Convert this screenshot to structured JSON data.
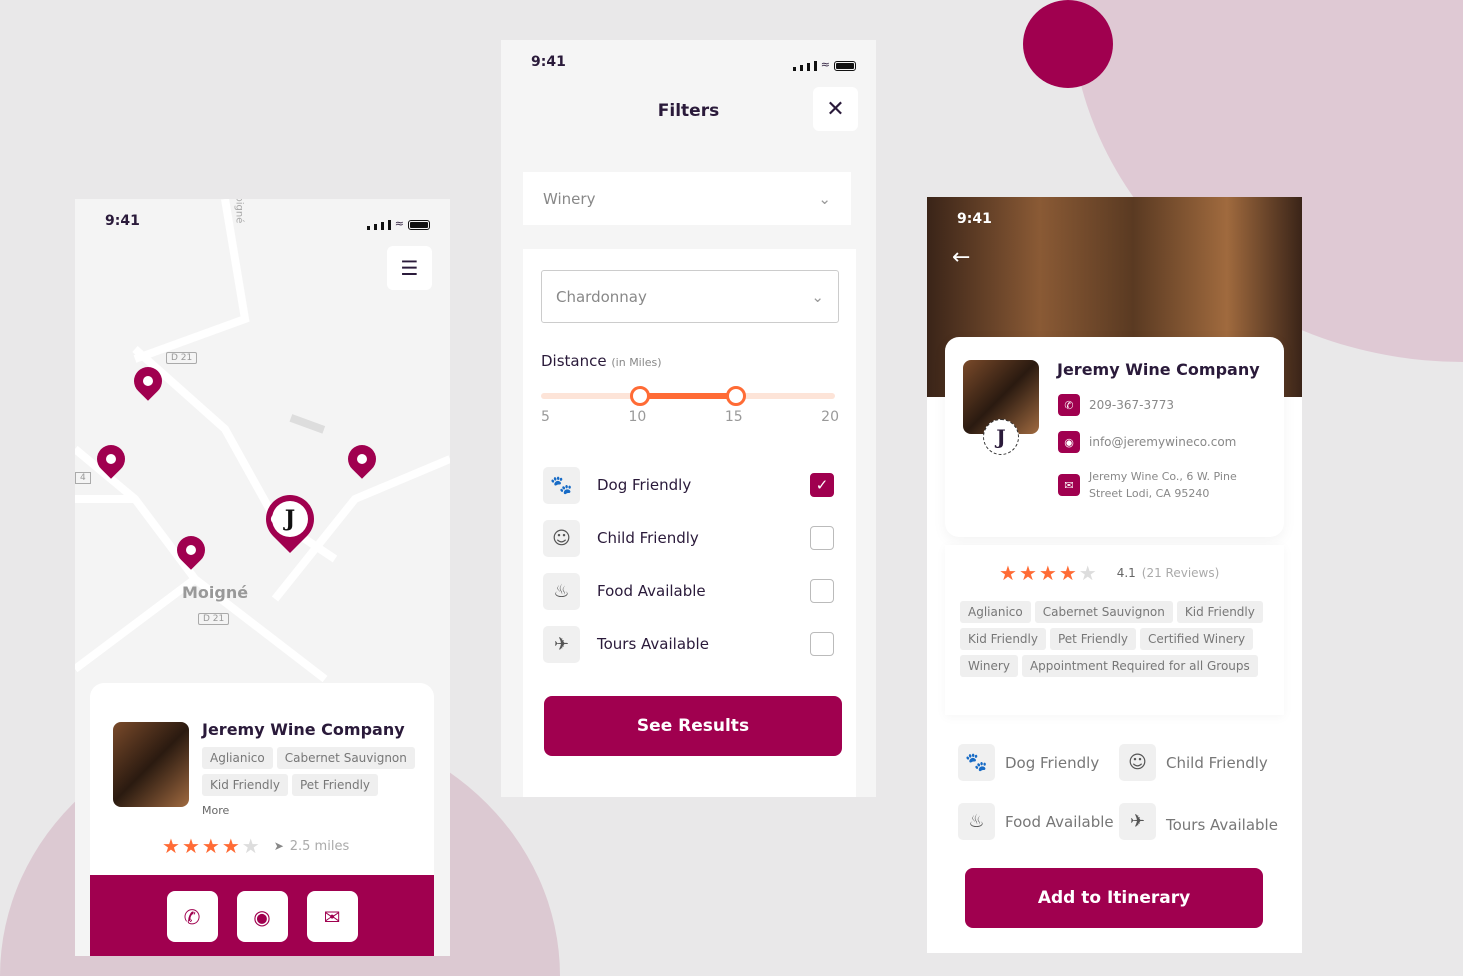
{
  "colors": {
    "brand": "#a0004f",
    "star": "#ff6b35"
  },
  "map_screen": {
    "time": "9:41",
    "map_labels": {
      "town": "Moigné",
      "road1": "D 21",
      "road2": "D 21",
      "road3": "oigné",
      "road4": "4"
    },
    "card": {
      "name": "Jeremy Wine Company",
      "tags": [
        "Aglianico",
        "Cabernet Sauvignon",
        "Kid Friendly",
        "Pet Friendly"
      ],
      "more": "More",
      "rating": 4,
      "distance": "2.5 miles"
    },
    "actions": [
      "phone-icon",
      "location-icon",
      "mail-icon"
    ]
  },
  "filters_screen": {
    "time": "9:41",
    "title": "Filters",
    "type_select": "Winery",
    "varietal_select": "Chardonnay",
    "distance_label": "Distance",
    "distance_unit": "(in Miles)",
    "slider": {
      "min": 5,
      "max": 20,
      "low": 10,
      "high": 15
    },
    "ticks": [
      "5",
      "10",
      "15",
      "20"
    ],
    "options": [
      {
        "label": "Dog Friendly",
        "checked": true,
        "icon": "paw-icon"
      },
      {
        "label": "Child Friendly",
        "checked": false,
        "icon": "baby-icon"
      },
      {
        "label": "Food Available",
        "checked": false,
        "icon": "food-icon"
      },
      {
        "label": "Tours Available",
        "checked": false,
        "icon": "plane-icon"
      }
    ],
    "submit": "See Results"
  },
  "detail_screen": {
    "time": "9:41",
    "name": "Jeremy Wine Company",
    "phone": "209-367-3773",
    "email": "info@jeremywineco.com",
    "address_line1": "Jeremy Wine Co., 6 W. Pine",
    "address_line2": "Street Lodi, CA 95240",
    "rating_value": "4.1",
    "reviews": "(21 Reviews)",
    "rating": 4,
    "tags": [
      "Aglianico",
      "Cabernet Sauvignon",
      "Kid Friendly",
      "Kid Friendly",
      "Pet Friendly",
      "Certified Winery",
      "Winery",
      "Appointment Required for all Groups"
    ],
    "amenities": [
      "Dog Friendly",
      "Child Friendly",
      "Food Available",
      "Tours Available"
    ],
    "cta": "Add to Itinerary"
  }
}
